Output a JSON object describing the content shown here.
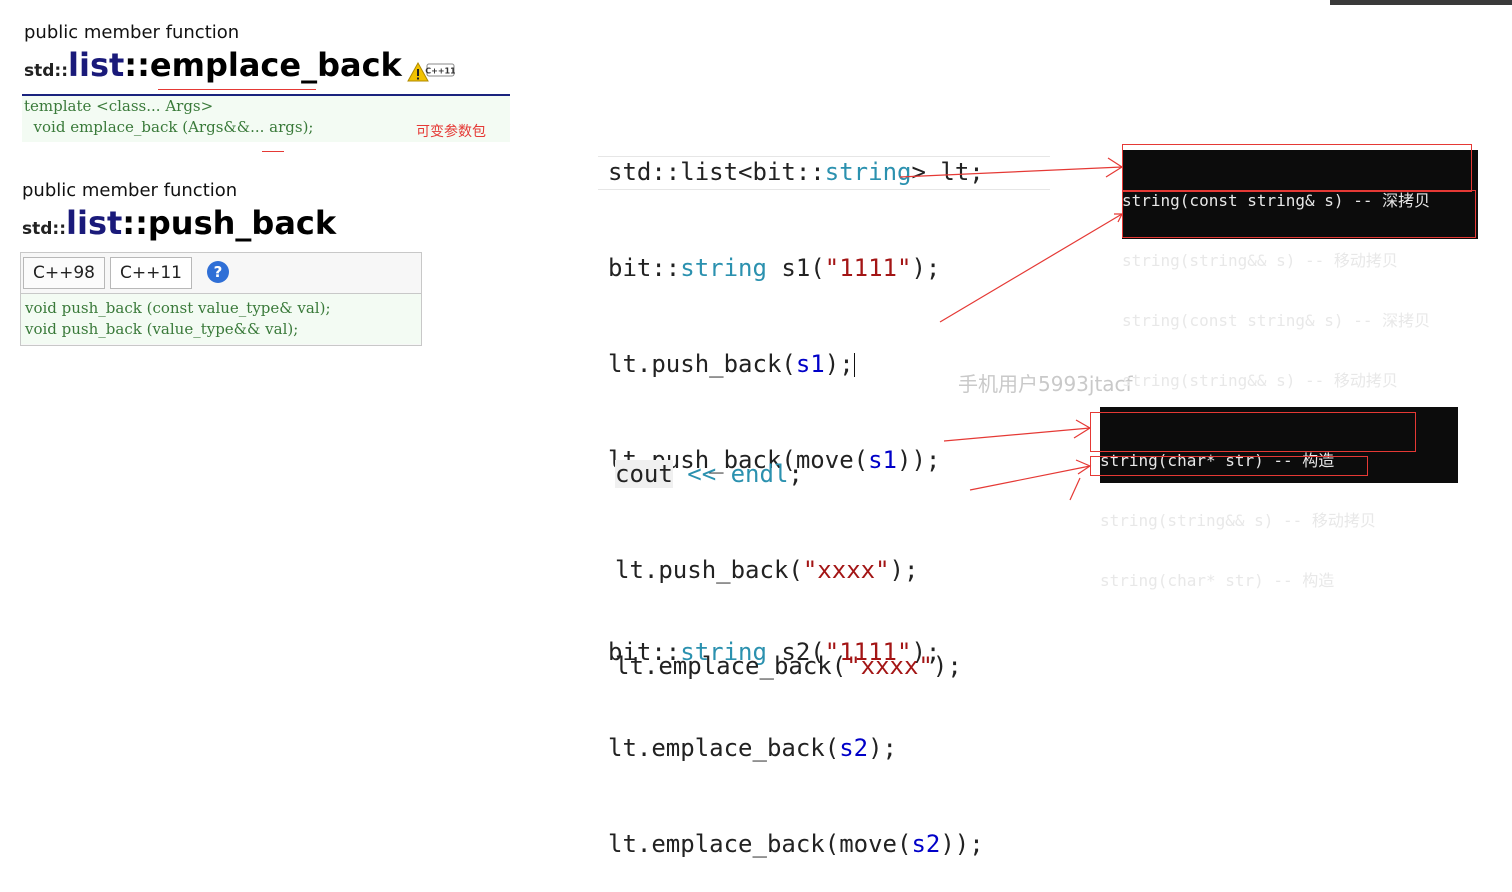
{
  "emplace_ref": {
    "kind": "public member function",
    "ns": "std::",
    "cls": "list",
    "sep": "::",
    "fn": "emplace_back",
    "badge": "C++11",
    "decl_line1": "template <class... Args>",
    "decl_line2": "  void emplace_back (Args&&... args);",
    "note": "可变参数包"
  },
  "push_ref": {
    "kind": "public member function",
    "ns": "std::",
    "cls": "list",
    "sep": "::",
    "fn": "push_back",
    "tabs": [
      "C++98",
      "C++11"
    ],
    "help": "?",
    "decl_line1": "void push_back (const value_type& val);",
    "decl_line2": "void push_back (value_type&& val);"
  },
  "code": {
    "l1": {
      "a": "std::list<",
      "b": "bit",
      "c": "::",
      "d": "string",
      "e": "> lt;"
    },
    "l2": {
      "a": "bit::",
      "b": "string",
      "c": " s1(",
      "d": "\"1111\"",
      "e": ");"
    },
    "l3": {
      "a": "lt.push_back(",
      "b": "s1",
      "c": ");"
    },
    "l4": {
      "a": "lt.push_back(move(",
      "b": "s1",
      "c": "));"
    },
    "l5": {
      "a": "bit::",
      "b": "string",
      "c": " s2(",
      "d": "\"1111\"",
      "e": ");"
    },
    "l6": {
      "a": "lt.emplace_back(",
      "b": "s2",
      "c": ");"
    },
    "l7": {
      "a": "lt.emplace_back(move(",
      "b": "s2",
      "c": "));"
    },
    "l8": {
      "a": "cout",
      "b": " << ",
      "c": "endl",
      "d": ";"
    },
    "l9": {
      "a": "lt.push_back(",
      "b": "\"xxxx\"",
      "c": ");"
    },
    "l10": {
      "a": "lt.emplace_back(",
      "b": "\"xxxx\"",
      "c": ");"
    }
  },
  "terminal1": [
    "string(const string& s) -- 深拷贝",
    "string(string&& s) -- 移动拷贝",
    "string(const string& s) -- 深拷贝",
    "string(string&& s) -- 移动拷贝"
  ],
  "terminal2": [
    "string(char* str) -- 构造",
    "string(string&& s) -- 移动拷贝",
    "string(char* str) -- 构造"
  ],
  "watermark": "手机用户5993jtacf",
  "colors": {
    "annotation": "#e53935",
    "declBorder": "#1a237e",
    "declText": "#3a7a3a"
  }
}
